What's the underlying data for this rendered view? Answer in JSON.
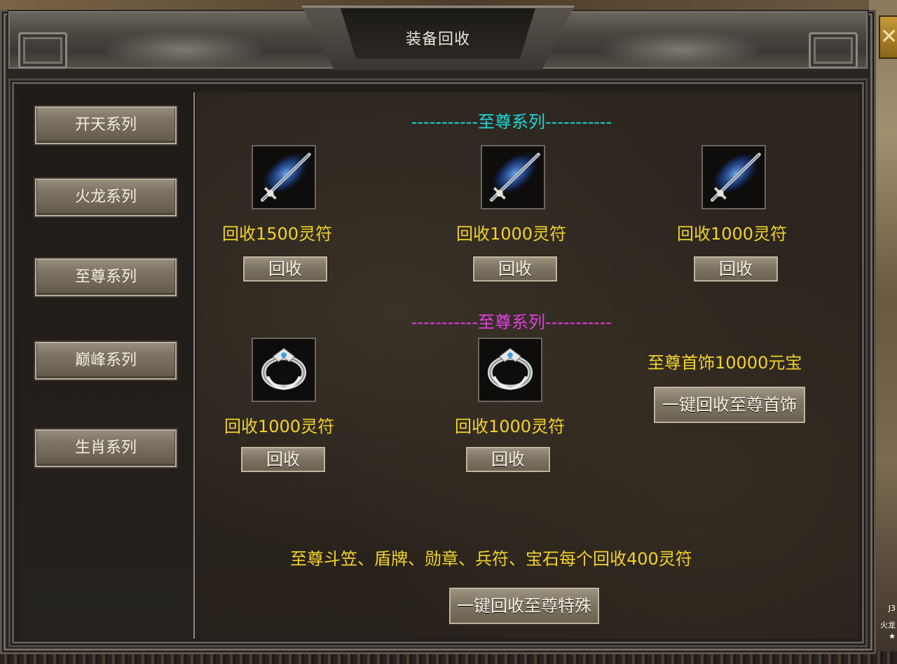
{
  "window": {
    "title": "装备回收",
    "close_label": "✕"
  },
  "sidebar": {
    "items": [
      {
        "label": "开天系列"
      },
      {
        "label": "火龙系列"
      },
      {
        "label": "至尊系列"
      },
      {
        "label": "巅峰系列"
      },
      {
        "label": "生肖系列"
      }
    ]
  },
  "weapons": {
    "heading": "-----------至尊系列-----------",
    "items": [
      {
        "icon": "sword-icon",
        "cost": "回收1500灵符",
        "button": "回收"
      },
      {
        "icon": "sword-icon",
        "cost": "回收1000灵符",
        "button": "回收"
      },
      {
        "icon": "sword-icon",
        "cost": "回收1000灵符",
        "button": "回收"
      }
    ]
  },
  "accessories": {
    "heading": "-----------至尊系列-----------",
    "items": [
      {
        "icon": "ring-icon",
        "cost": "回收1000灵符",
        "button": "回收"
      },
      {
        "icon": "ring-icon",
        "cost": "回收1000灵符",
        "button": "回收"
      }
    ],
    "bulk_note": "至尊首饰10000元宝",
    "bulk_button": "一键回收至尊首饰"
  },
  "special": {
    "note": "至尊斗笠、盾牌、勋章、兵符、宝石每个回收400灵符",
    "button": "一键回收至尊特殊"
  },
  "world": {
    "right_labels": [
      "J3",
      "火龙",
      "★"
    ]
  },
  "colors": {
    "cost_text": "#f2d22a",
    "heading_weapons": "#1fd6d6",
    "heading_accessories": "#e040e0"
  }
}
